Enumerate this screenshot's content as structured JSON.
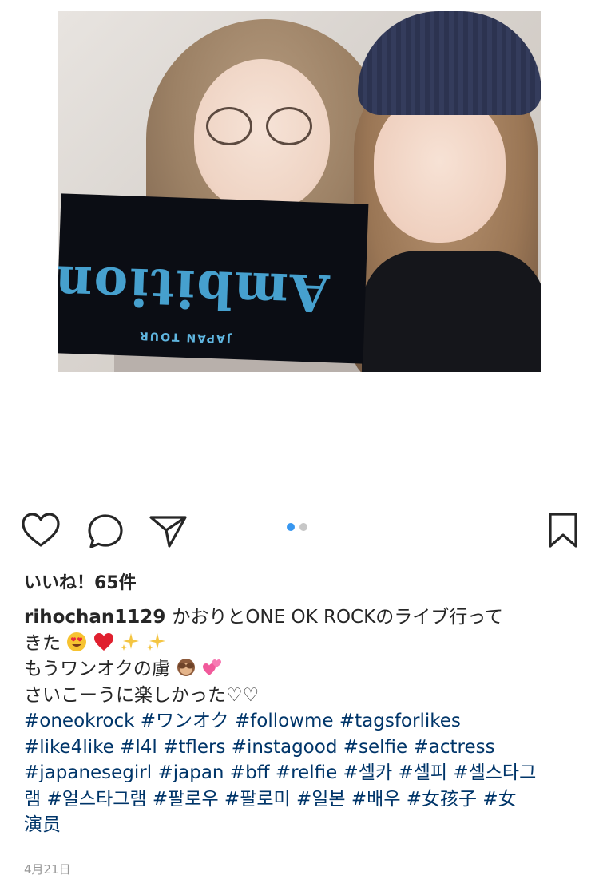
{
  "post": {
    "likes_text": "いいね！65件",
    "username": "rihochan1129",
    "caption_line1": "かおりとONE OK ROCKのライブ行って",
    "caption_line2": "きた",
    "caption_line3": "もうワンオクの虜",
    "caption_line4": "さいこーうに楽しかった♡♡",
    "hashtag_line1": "#oneokrock #ワンオク #followme #tagsforlikes",
    "hashtag_line2": "#like4like #l4l #tflers #instagood  #selfie #actress",
    "hashtag_line3": "#japanesegirl #japan #bff #relfie #셀카 #셀피 #셀스타그",
    "hashtag_line4": "램 #얼스타그램 #팔로우 #팔로미 #일본 #배우 #女孩子 #女",
    "hashtag_line5": "演员",
    "date": "4月21日"
  },
  "photo": {
    "towel_text": "Ambitions",
    "towel_subtext": "JAPAN TOUR"
  },
  "carousel": {
    "total": 2,
    "active_index": 0
  },
  "colors": {
    "hashtag": "#003569",
    "active_dot": "#3897f0",
    "inactive_dot": "#c7c7c7",
    "text": "#262626",
    "date": "#999999"
  },
  "icons": [
    "heart-icon",
    "comment-icon",
    "share-icon",
    "bookmark-icon",
    "smiling-face-heart-eyes-icon",
    "red-heart-icon",
    "sparkles-icon",
    "see-no-evil-monkey-icon",
    "two-hearts-icon"
  ]
}
